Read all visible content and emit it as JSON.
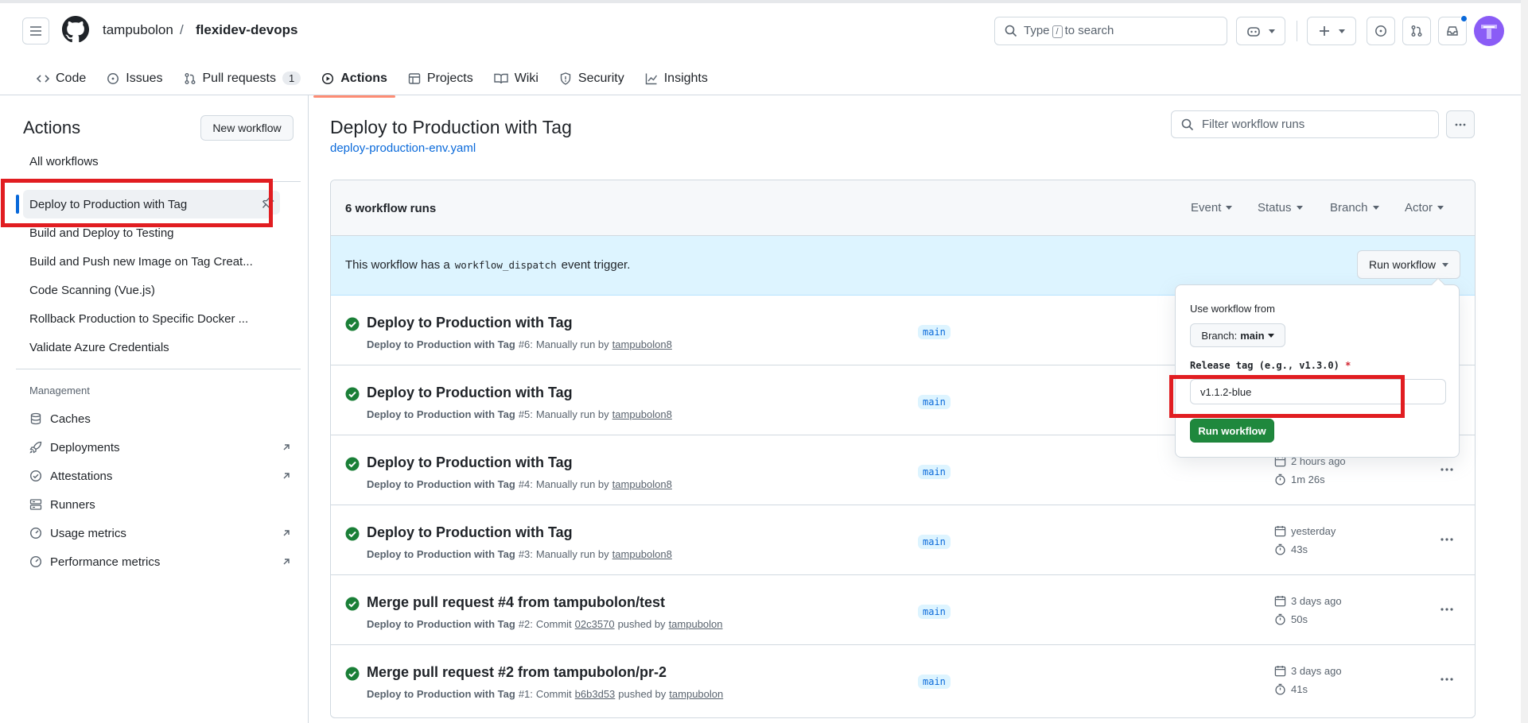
{
  "header": {
    "owner": "tampubolon",
    "separator": "/",
    "repo": "flexidev-devops",
    "search": {
      "prefix": "Type",
      "key": "/",
      "suffix": "to search"
    }
  },
  "tabs": [
    {
      "label": "Code"
    },
    {
      "label": "Issues"
    },
    {
      "label": "Pull requests",
      "count": "1"
    },
    {
      "label": "Actions"
    },
    {
      "label": "Projects"
    },
    {
      "label": "Wiki"
    },
    {
      "label": "Security"
    },
    {
      "label": "Insights"
    }
  ],
  "sidebar": {
    "title": "Actions",
    "new_workflow": "New workflow",
    "all_workflows": "All workflows",
    "workflows": [
      "Deploy to Production with Tag",
      "Build and Deploy to Testing",
      "Build and Push new Image on Tag Creat...",
      "Code Scanning (Vue.js)",
      "Rollback Production to Specific Docker ...",
      "Validate Azure Credentials"
    ],
    "management_title": "Management",
    "management": [
      "Caches",
      "Deployments",
      "Attestations",
      "Runners",
      "Usage metrics",
      "Performance metrics"
    ]
  },
  "main": {
    "title": "Deploy to Production with Tag",
    "file": "deploy-production-env.yaml",
    "filter_placeholder": "Filter workflow runs",
    "runs_count": "6 workflow runs",
    "filters": [
      "Event",
      "Status",
      "Branch",
      "Actor"
    ],
    "banner": {
      "prefix": "This workflow has a",
      "code": "workflow_dispatch",
      "suffix": "event trigger."
    },
    "run_workflow_button": "Run workflow",
    "runs": [
      {
        "title": "Deploy to Production with Tag",
        "wf": "Deploy to Production with Tag",
        "num": "#6:",
        "how": "Manually run by",
        "user": "tampubolon8",
        "branch": "main",
        "when": "",
        "dur": ""
      },
      {
        "title": "Deploy to Production with Tag",
        "wf": "Deploy to Production with Tag",
        "num": "#5:",
        "how": "Manually run by",
        "user": "tampubolon8",
        "branch": "main",
        "when": "",
        "dur": ""
      },
      {
        "title": "Deploy to Production with Tag",
        "wf": "Deploy to Production with Tag",
        "num": "#4:",
        "how": "Manually run by",
        "user": "tampubolon8",
        "branch": "main",
        "when": "2 hours ago",
        "dur": "1m 26s"
      },
      {
        "title": "Deploy to Production with Tag",
        "wf": "Deploy to Production with Tag",
        "num": "#3:",
        "how": "Manually run by",
        "user": "tampubolon8",
        "branch": "main",
        "when": "yesterday",
        "dur": "43s"
      },
      {
        "title": "Merge pull request #4 from tampubolon/test",
        "wf": "Deploy to Production with Tag",
        "num": "#2:",
        "how": "Commit",
        "commit": "02c3570",
        "how2": "pushed by",
        "user": "tampubolon",
        "branch": "main",
        "when": "3 days ago",
        "dur": "50s"
      },
      {
        "title": "Merge pull request #2 from tampubolon/pr-2",
        "wf": "Deploy to Production with Tag",
        "num": "#1:",
        "how": "Commit",
        "commit": "b6b3d53",
        "how2": "pushed by",
        "user": "tampubolon",
        "branch": "main",
        "when": "3 days ago",
        "dur": "41s"
      }
    ]
  },
  "popup": {
    "use_from": "Use workflow from",
    "branch_prefix": "Branch:",
    "branch_value": "main",
    "release_label": "Release tag (e.g., v1.3.0)",
    "required_mark": "*",
    "release_value": "v1.1.2-blue",
    "submit": "Run workflow"
  },
  "colors": {
    "accent": "#0969da",
    "success": "#1a7f37",
    "highlight": "#e11d21",
    "tab_underline": "#fd8c73"
  }
}
